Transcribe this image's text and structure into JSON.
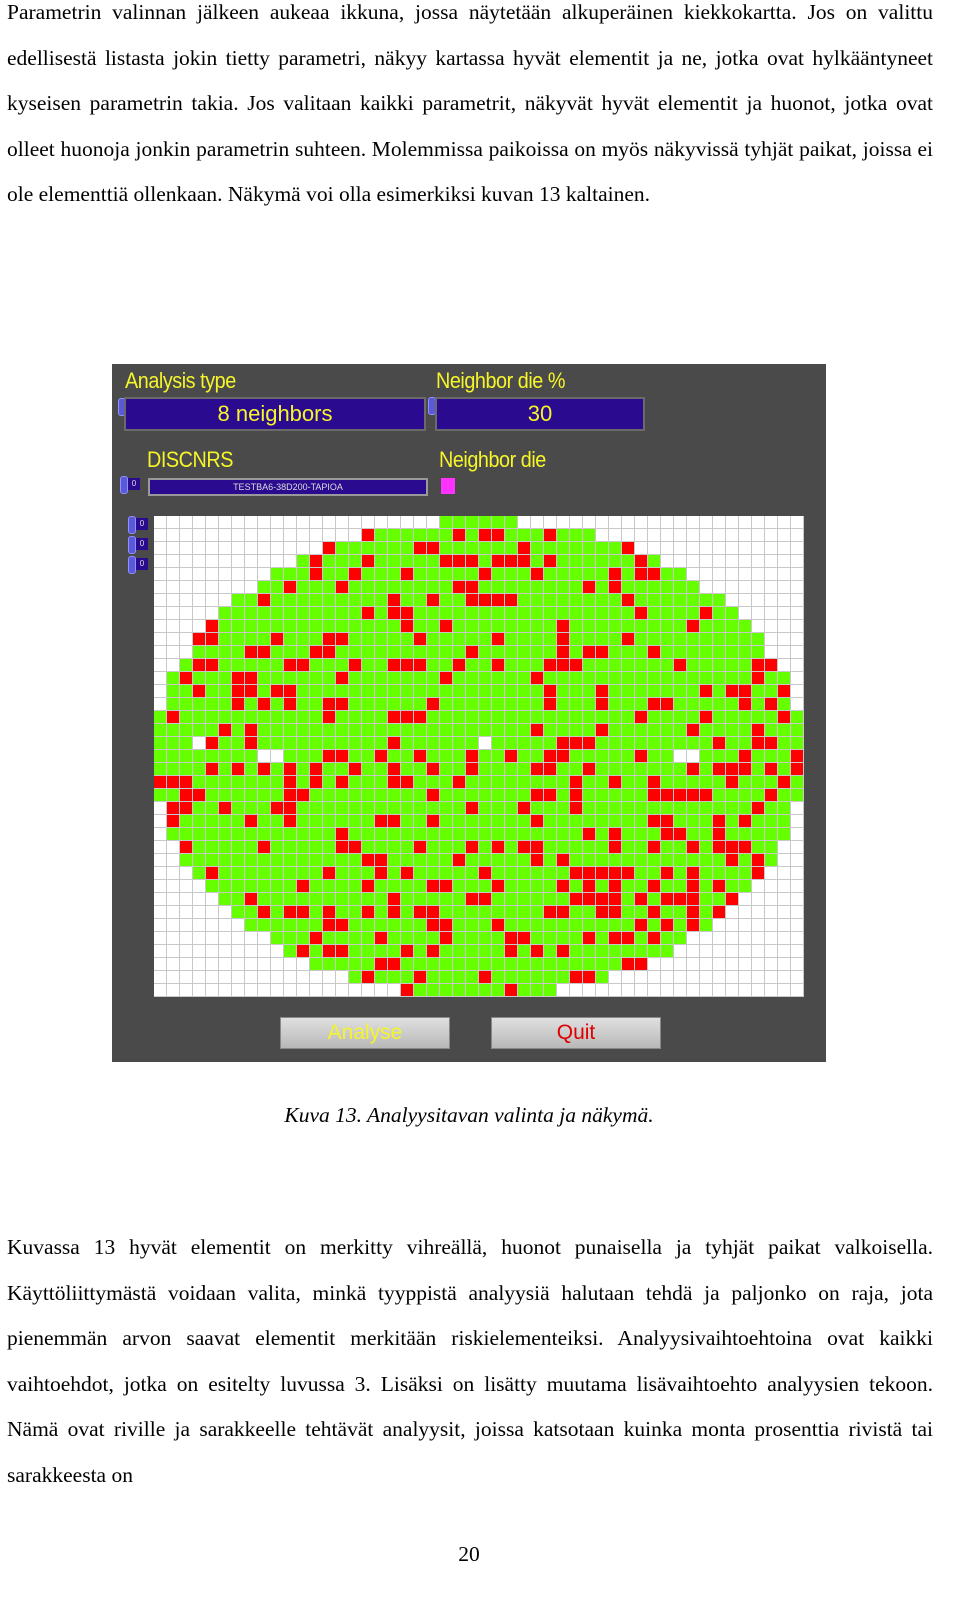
{
  "paragraph1": "Parametrin valinnan jälkeen aukeaa ikkuna, jossa näytetään alkuperäinen kiekkokartta. Jos on valittu edellisestä listasta jokin tietty parametri, näkyy kartassa hyvät elementit ja ne, jotka ovat hylkääntyneet kyseisen parametrin takia. Jos valitaan kaikki parametrit, näkyvät hyvät elementit ja huonot, jotka ovat olleet huonoja jonkin parametrin suhteen. Molemmissa paikoissa on myös näkyvissä tyhjät paikat, joissa ei ole elementtiä ollenkaan. Näkymä voi olla esimerkiksi kuvan 13 kaltainen.",
  "app": {
    "analysis_type_label": "Analysis type",
    "analysis_type_value": "8 neighbors",
    "neighbor_pct_label": "Neighbor die %",
    "neighbor_pct_value": "30",
    "parameter_label": "DISCNRS",
    "parameter_index": "0",
    "wafer_id": "TESTBA6-38D200-TAPIOA",
    "neighbor_die_label": "Neighbor die",
    "neighbor_die_color": "#ff33ff",
    "indices": [
      "0",
      "0",
      "0"
    ],
    "analyse_label": "Analyse",
    "quit_label": "Quit",
    "colors": {
      "good": "#66ff00",
      "bad": "#ff0000",
      "empty": "#ffffff"
    }
  },
  "caption": "Kuva 13. Analyysitavan valinta ja näkymä.",
  "paragraph2": "Kuvassa 13 hyvät elementit on merkitty vihreällä, huonot punaisella ja tyhjät paikat valkoisella. Käyttöliittymästä voidaan valita, minkä tyyppistä analyysiä halutaan tehdä ja paljonko on raja, jota pienemmän arvon saavat elementit merkitään riskielementeiksi. Analyysivaihtoehtoina ovat kaikki vaihtoehdot, jotka on esitelty luvussa 3. Lisäksi on lisätty muutama lisävaihtoehto analyysien tekoon. Nämä ovat riville ja sarakkeelle tehtävät analyysit, joissa katsotaan kuinka monta prosenttia rivistä tai sarakkeesta on",
  "page_number": "20"
}
